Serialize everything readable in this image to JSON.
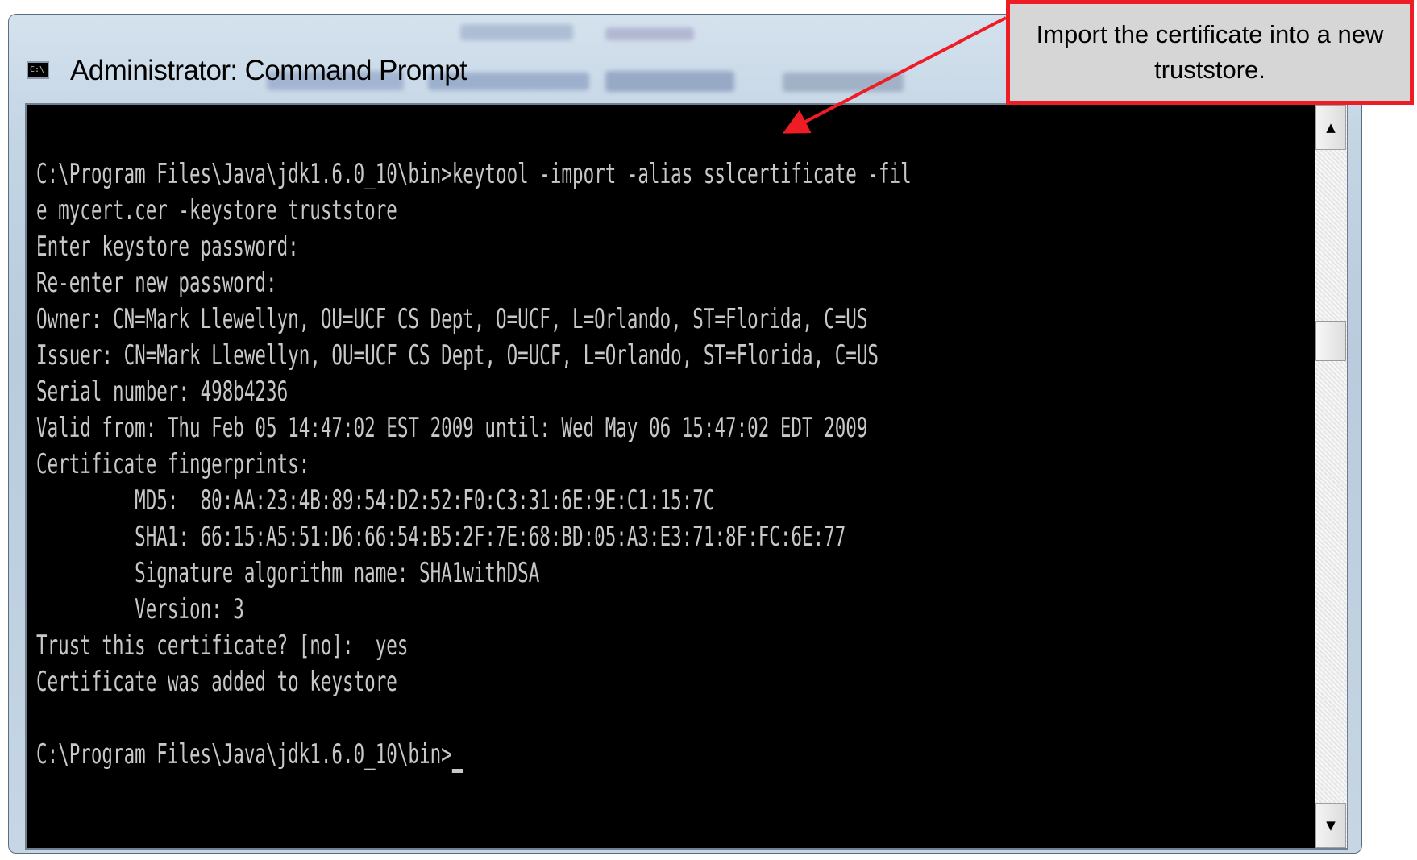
{
  "window": {
    "title": "Administrator: Command Prompt",
    "icon": "cmd-icon"
  },
  "console": {
    "lines": [
      "C:\\Program Files\\Java\\jdk1.6.0_10\\bin>keytool -import -alias sslcertificate -fil",
      "e mycert.cer -keystore truststore",
      "Enter keystore password:",
      "Re-enter new password:",
      "Owner: CN=Mark Llewellyn, OU=UCF CS Dept, O=UCF, L=Orlando, ST=Florida, C=US",
      "Issuer: CN=Mark Llewellyn, OU=UCF CS Dept, O=UCF, L=Orlando, ST=Florida, C=US",
      "Serial number: 498b4236",
      "Valid from: Thu Feb 05 14:47:02 EST 2009 until: Wed May 06 15:47:02 EDT 2009",
      "Certificate fingerprints:",
      "         MD5:  80:AA:23:4B:89:54:D2:52:F0:C3:31:6E:9E:C1:15:7C",
      "         SHA1: 66:15:A5:51:D6:66:54:B5:2F:7E:68:BD:05:A3:E3:71:8F:FC:6E:77",
      "         Signature algorithm name: SHA1withDSA",
      "         Version: 3",
      "Trust this certificate? [no]:  yes",
      "Certificate was added to keystore",
      ""
    ],
    "prompt": "C:\\Program Files\\Java\\jdk1.6.0_10\\bin>"
  },
  "scrollbar": {
    "up_icon": "scroll-up-arrow-icon",
    "down_icon": "scroll-down-arrow-icon"
  },
  "callout": {
    "text": "Import the certificate into a new truststore.",
    "border_color": "#ee1c25"
  }
}
